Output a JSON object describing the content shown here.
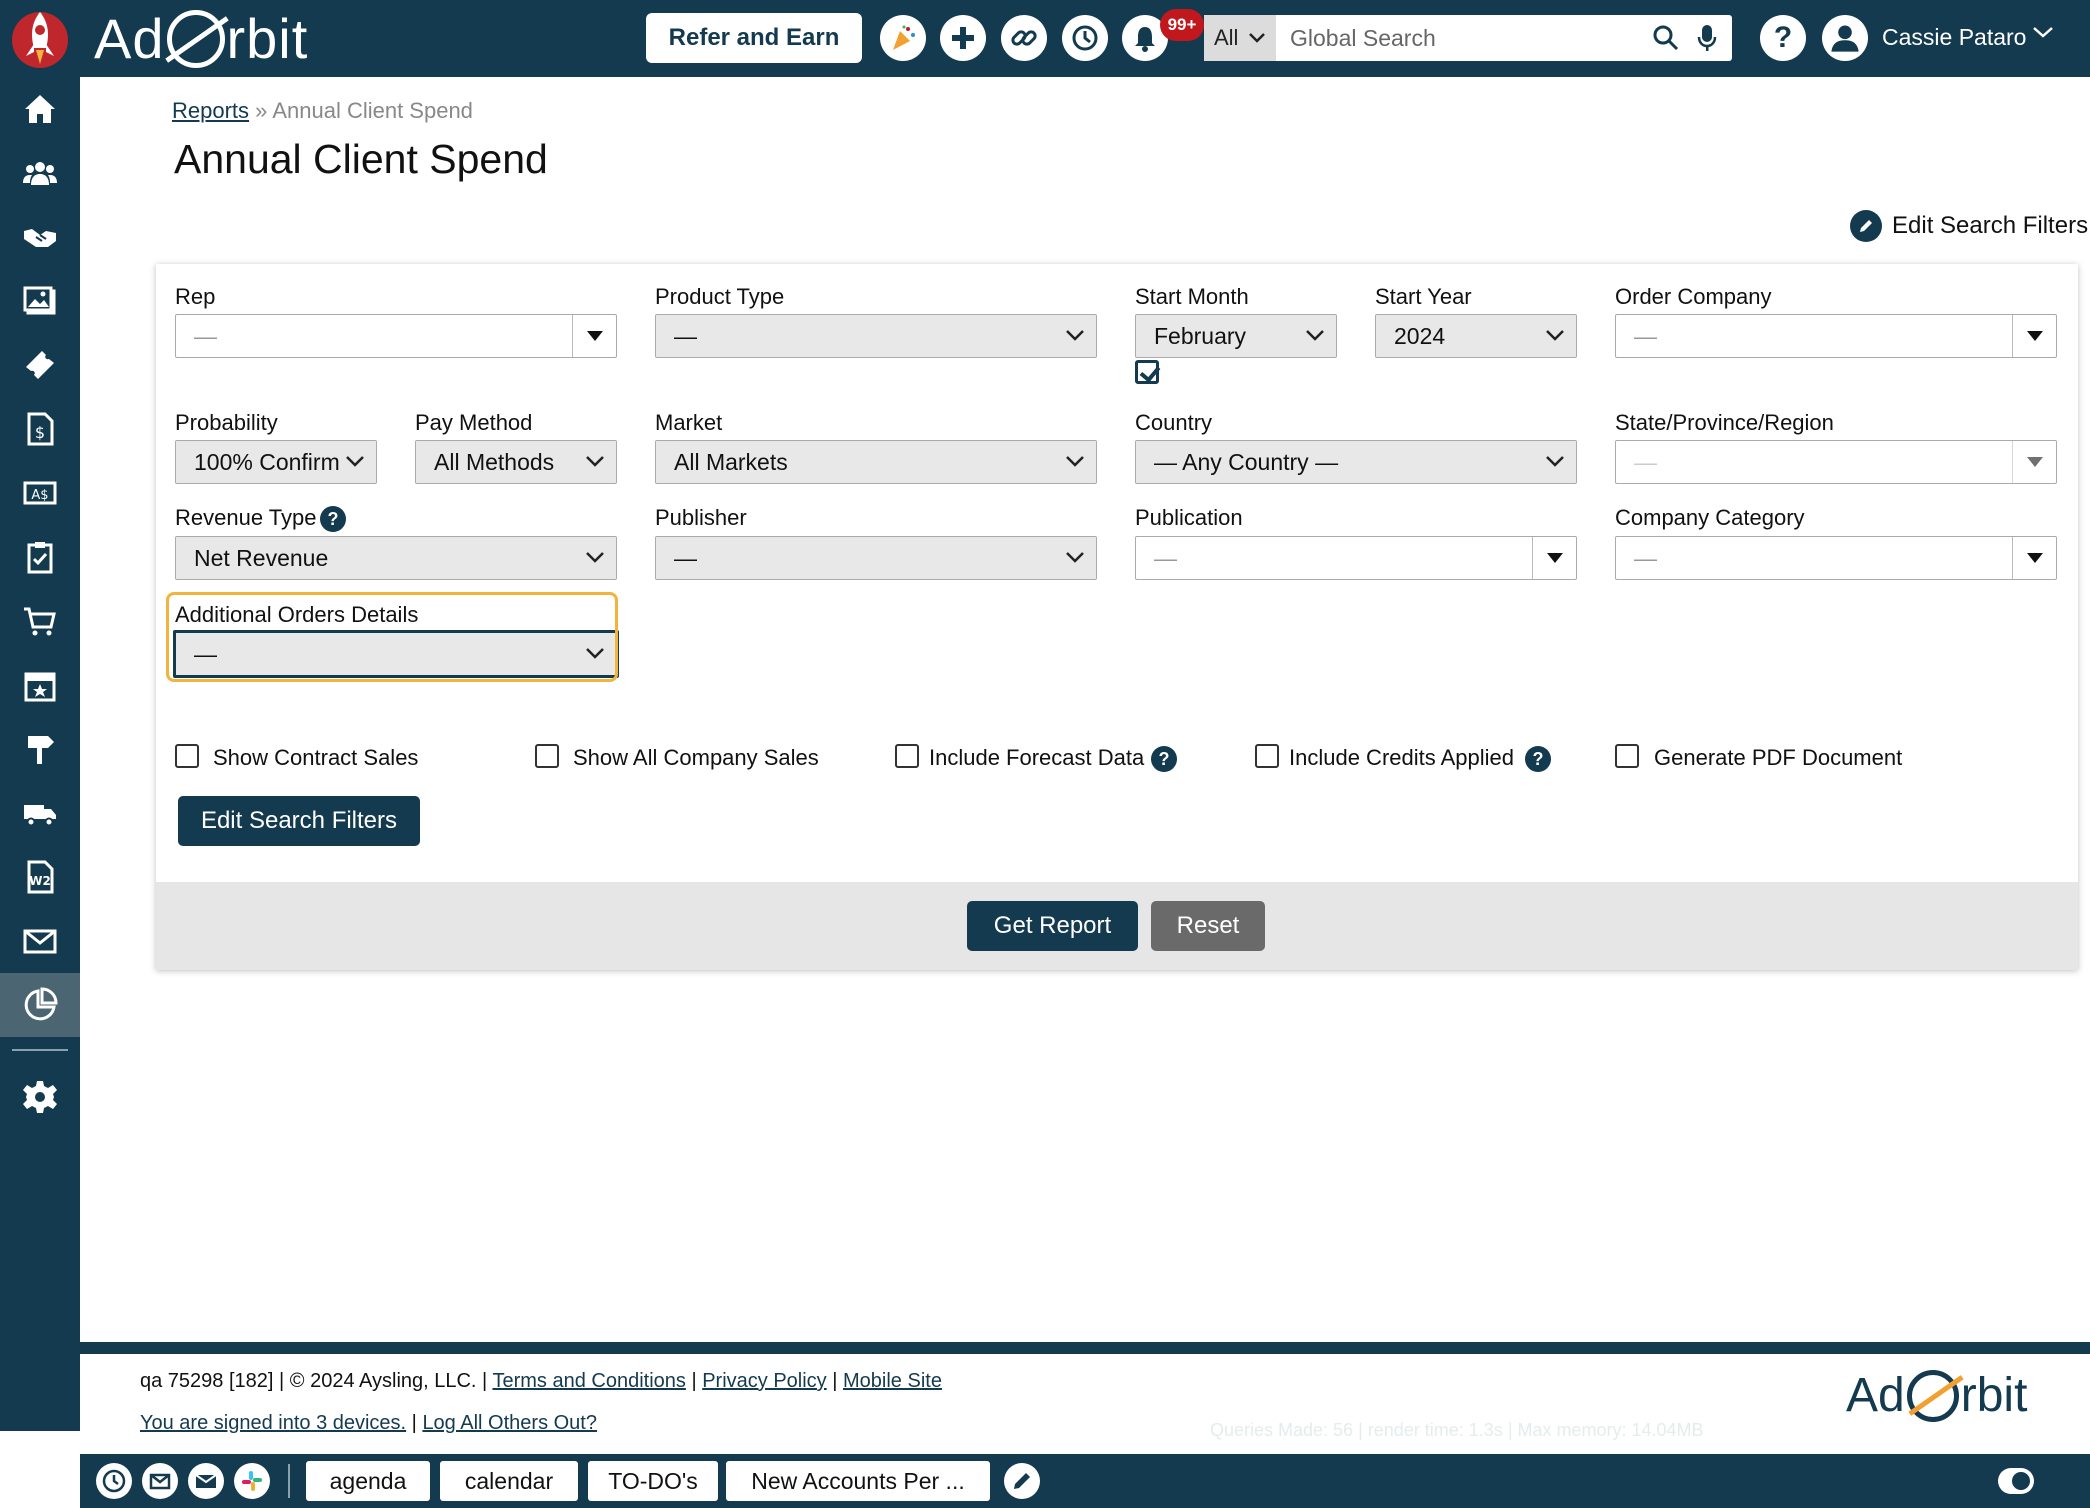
{
  "header": {
    "logo_text_pre": "Ad",
    "logo_text_post": "rbit",
    "refer_label": "Refer and Earn",
    "notification_count": "99+",
    "search": {
      "scope": "All",
      "placeholder": "Global Search"
    },
    "help_label": "?",
    "user_name": "Cassie Pataro"
  },
  "sidebar": {
    "items": [
      {
        "icon": "home-icon"
      },
      {
        "icon": "contacts-icon"
      },
      {
        "icon": "handshake-icon"
      },
      {
        "icon": "media-icon"
      },
      {
        "icon": "ticket-icon"
      },
      {
        "icon": "invoice-icon"
      },
      {
        "icon": "currency-icon"
      },
      {
        "icon": "clipboard-icon"
      },
      {
        "icon": "cart-icon"
      },
      {
        "icon": "calendar-star-icon"
      },
      {
        "icon": "signpost-icon"
      },
      {
        "icon": "truck-icon"
      },
      {
        "icon": "w2-icon"
      },
      {
        "icon": "mail-icon"
      },
      {
        "icon": "reports-icon"
      },
      {
        "icon": "gear-icon"
      }
    ],
    "active_icon": "reports-icon"
  },
  "breadcrumb": {
    "parent": "Reports",
    "separator": "»",
    "current": "Annual Client Spend"
  },
  "page_title": "Annual Client Spend",
  "edit_filters_link": "Edit Search Filters",
  "filters": {
    "rep": {
      "label": "Rep",
      "value": "—"
    },
    "product_type": {
      "label": "Product Type",
      "value": "—"
    },
    "start_month": {
      "label": "Start Month",
      "value": "February",
      "checked": true
    },
    "start_year": {
      "label": "Start Year",
      "value": "2024"
    },
    "order_company": {
      "label": "Order Company",
      "value": "—"
    },
    "probability": {
      "label": "Probability",
      "value": "100% Confirm"
    },
    "pay_method": {
      "label": "Pay Method",
      "value": "All Methods"
    },
    "market": {
      "label": "Market",
      "value": "All Markets"
    },
    "country": {
      "label": "Country",
      "value": "— Any Country —"
    },
    "state": {
      "label": "State/Province/Region",
      "value": "—"
    },
    "revenue_type": {
      "label": "Revenue Type",
      "value": "Net Revenue"
    },
    "publisher": {
      "label": "Publisher",
      "value": "—"
    },
    "publication": {
      "label": "Publication",
      "value": "—"
    },
    "company_category": {
      "label": "Company Category",
      "value": "—"
    },
    "additional_orders": {
      "label": "Additional Orders Details",
      "value": "—"
    }
  },
  "checkboxes": [
    {
      "label": "Show Contract Sales",
      "checked": false
    },
    {
      "label": "Show All Company Sales",
      "checked": false
    },
    {
      "label": "Include Forecast Data",
      "checked": false
    },
    {
      "label": "Include Credits Applied",
      "checked": false
    },
    {
      "label": "Generate PDF Document",
      "checked": false
    }
  ],
  "buttons": {
    "edit_filters": "Edit Search Filters",
    "get_report": "Get Report",
    "reset": "Reset"
  },
  "footer": {
    "build": "qa 75298 [182]",
    "copyright": "© 2024 Aysling, LLC.",
    "terms": "Terms and Conditions",
    "privacy": "Privacy Policy",
    "mobile": "Mobile Site",
    "devices": "You are signed into 3 devices.",
    "logout_others": "Log All Others Out?",
    "stats": "Queries Made: 56 | render time: 1.3s | Max memory: 14.04MB",
    "logo_pre": "Ad",
    "logo_post": "rbit"
  },
  "taskbar": {
    "tabs": [
      "agenda",
      "calendar",
      "TO-DO's",
      "New Accounts Per ..."
    ]
  },
  "colors": {
    "primary": "#133a4f",
    "focus": "#f2b43c",
    "badge": "#c0181d"
  }
}
